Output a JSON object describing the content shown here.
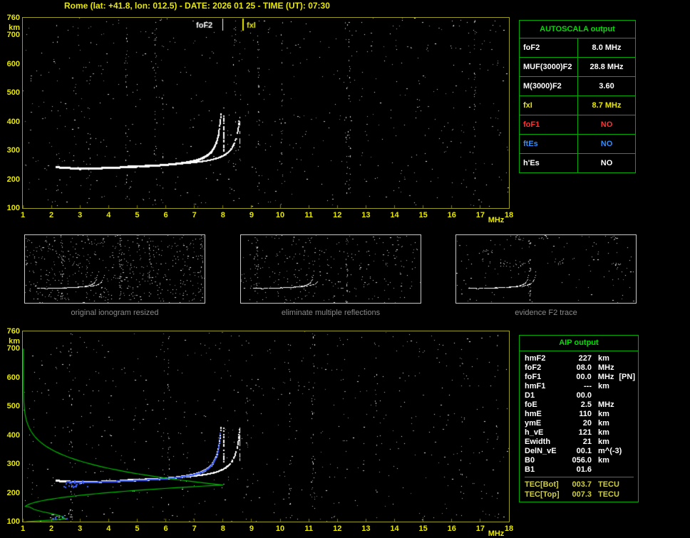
{
  "title": "Rome (lat: +41.8, lon: 012.5) - DATE: 2026 01 25 - TIME (UT): 07:30",
  "colors": {
    "yellow": "#e8e800",
    "plot_border": "#9b9b1e",
    "table_border_green": "#00aa00",
    "table_title_green": "#00dd00",
    "profile_green": "#00bb00",
    "red": "#ff3030",
    "blue": "#2d8cff",
    "trace_blue": "#3a5cff",
    "white": "#ffffff",
    "caption_gray": "#8a8a8a"
  },
  "axes": {
    "x_ticks": [
      "1",
      "2",
      "3",
      "4",
      "5",
      "6",
      "7",
      "8",
      "9",
      "10",
      "11",
      "12",
      "13",
      "14",
      "15",
      "16",
      "17",
      "18"
    ],
    "x_unit": "MHz",
    "y_ticks": [
      "760",
      "700",
      "600",
      "500",
      "400",
      "300",
      "200",
      "100"
    ],
    "y_unit": "km"
  },
  "top_plot": {
    "foF2_label": "foF2",
    "fxI_label": "fxI"
  },
  "autoscala_table": {
    "title": "AUTOSCALA output",
    "rows": [
      {
        "label": "foF2",
        "value": "8.0 MHz"
      },
      {
        "label": "MUF(3000)F2",
        "value": "28.8 MHz"
      },
      {
        "label": "M(3000)F2",
        "value": "3.60"
      },
      {
        "label": "fxI",
        "value": "8.7 MHz"
      },
      {
        "label": "foF1",
        "value": "NO"
      },
      {
        "label": "ftEs",
        "value": "NO"
      },
      {
        "label": "h'Es",
        "value": "NO"
      }
    ]
  },
  "thumbnails": [
    {
      "caption": "original ionogram resized"
    },
    {
      "caption": "eliminate multiple reflections"
    },
    {
      "caption": "evidence F2 trace"
    }
  ],
  "aip_table": {
    "title": "AIP output",
    "rows": [
      {
        "label": "hmF2",
        "value": "227",
        "unit": "km"
      },
      {
        "label": "foF2",
        "value": "08.0",
        "unit": "MHz"
      },
      {
        "label": "foF1",
        "value": "00.0",
        "unit": "MHz",
        "note": "[PN]"
      },
      {
        "label": "hmF1",
        "value": "---",
        "unit": "km"
      },
      {
        "label": "D1",
        "value": "00.0",
        "unit": ""
      },
      {
        "label": "foE",
        "value": "2.5",
        "unit": "MHz"
      },
      {
        "label": "hmE",
        "value": "110",
        "unit": "km"
      },
      {
        "label": "ymE",
        "value": "20",
        "unit": "km"
      },
      {
        "label": "h_vE",
        "value": "121",
        "unit": "km"
      },
      {
        "label": "Ewidth",
        "value": "21",
        "unit": "km"
      },
      {
        "label": "DelN_vE",
        "value": "00.1",
        "unit": "m^(-3)"
      },
      {
        "label": "B0",
        "value": "056.0",
        "unit": "km"
      },
      {
        "label": "B1",
        "value": "01.6",
        "unit": ""
      }
    ],
    "tec_rows": [
      {
        "label": "TEC[Bot]",
        "value": "003.7",
        "unit": "TECU"
      },
      {
        "label": "TEC[Top]",
        "value": "007.3",
        "unit": "TECU"
      }
    ]
  },
  "chart_data": {
    "type": "scatter",
    "description": "Vertical-incidence ionogram: virtual height (km) vs sounding frequency (MHz); white dots = echo trace, green = inverted electron density profile, blue = identified F2 trace",
    "x_range": [
      1,
      18
    ],
    "y_range": [
      100,
      760
    ],
    "foF2_MHz": 8.0,
    "fxI_MHz": 8.7,
    "f2_trace_points": [
      [
        2.2,
        246
      ],
      [
        3.0,
        238
      ],
      [
        4.0,
        240
      ],
      [
        5.0,
        245
      ],
      [
        6.0,
        252
      ],
      [
        7.0,
        267
      ],
      [
        7.5,
        290
      ],
      [
        7.8,
        322
      ],
      [
        7.9,
        400
      ],
      [
        8.0,
        428
      ]
    ],
    "profile": {
      "hmF2_km": 227,
      "foF2_MHz": 8.0,
      "foE_MHz": 2.5,
      "hmE_km": 110,
      "h_vE_km": 121,
      "top_km": 700
    },
    "render": {
      "trace_o": {
        "h0": 231,
        "slope": 2.2,
        "k": 26
      },
      "trace_x": {
        "h0": 235,
        "slope": 2.2,
        "k": 26
      },
      "e_profile": [
        [
          150,
          1.25
        ],
        [
          142,
          1.4
        ],
        [
          134,
          1.7
        ],
        [
          127,
          2.05
        ],
        [
          121,
          2.28
        ],
        [
          115,
          2.42
        ],
        [
          110,
          2.47
        ],
        [
          106,
          2.15
        ],
        [
          103,
          1.6
        ],
        [
          100,
          1.12
        ]
      ]
    }
  }
}
